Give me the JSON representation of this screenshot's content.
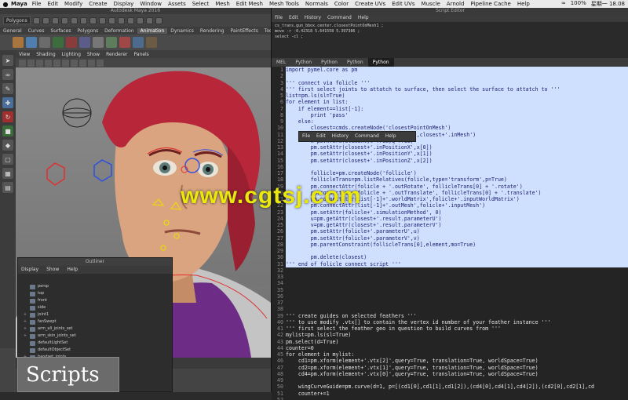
{
  "menubar": {
    "app": "Maya",
    "items": [
      "File",
      "Edit",
      "Modify",
      "Create",
      "Display",
      "Window",
      "Assets",
      "Select",
      "Mesh",
      "Edit Mesh",
      "Mesh Tools",
      "Normals",
      "Color",
      "Create UVs",
      "Edit UVs",
      "Muscle",
      "Arnold",
      "Pipeline Cache",
      "Help"
    ],
    "battery": "100%",
    "time": "星期一 18.08"
  },
  "maya": {
    "window_title": "Autodesk Maya 2016",
    "mode_select": "Polygons",
    "shelf_tabs": [
      "General",
      "Curves",
      "Surfaces",
      "Polygons",
      "Deformation",
      "Animation",
      "Dynamics",
      "Rendering",
      "PaintEffects",
      "Toon",
      "Muscle"
    ],
    "active_shelf_tab": "Animation",
    "panel_menu": [
      "View",
      "Shading",
      "Lighting",
      "Show",
      "Renderer",
      "Panels"
    ],
    "timeline_ticks": [
      "1",
      "40",
      "45",
      "50",
      "55"
    ]
  },
  "outliner": {
    "title": "Outliner",
    "menu": [
      "Display",
      "Show",
      "Help"
    ],
    "items": [
      {
        "label": "persp",
        "expand": ""
      },
      {
        "label": "top",
        "expand": ""
      },
      {
        "label": "front",
        "expand": ""
      },
      {
        "label": "side",
        "expand": ""
      },
      {
        "label": "joint1",
        "expand": "+"
      },
      {
        "label": "fanSwept",
        "expand": "+"
      },
      {
        "label": "arm_all_joints_set",
        "expand": "+"
      },
      {
        "label": "arm_skin_joints_set",
        "expand": "+"
      },
      {
        "label": "defaultLightSet",
        "expand": ""
      },
      {
        "label": "defaultObjectSet",
        "expand": ""
      },
      {
        "label": "handset_joints",
        "expand": "+"
      }
    ]
  },
  "caption": "Scripts",
  "watermark": "www.cgtsj.com",
  "script_editor": {
    "title": "Script Editor",
    "menu": [
      "File",
      "Edit",
      "History",
      "Command",
      "Help"
    ],
    "output_lines": [
      "cs_trans.gun_bbox.center.closestPointOnMesh1 ;",
      "move -r -0.42318 5.641558 5.397386 ;",
      "select -cl ;"
    ],
    "tabs": [
      "MEL",
      "Python",
      "Python",
      "Python",
      "Python"
    ],
    "active_tab": 4,
    "command_popup": [
      "File",
      "Edit",
      "History",
      "Command",
      "Help"
    ],
    "code_lines": [
      {
        "n": "1",
        "t": "import pymel.core as pm",
        "sel": true
      },
      {
        "n": "2",
        "t": "",
        "sel": true
      },
      {
        "n": "3",
        "t": "''' connect via folicle '''",
        "sel": true
      },
      {
        "n": "4",
        "t": "''' first select joints to attatch to surface, then select the surface to attatch to '''",
        "sel": true
      },
      {
        "n": "5",
        "t": "list=pm.ls(sl=True)",
        "sel": true
      },
      {
        "n": "6",
        "t": "for element in list:",
        "sel": true
      },
      {
        "n": "7",
        "t": "    if element==list[-1]:",
        "sel": true
      },
      {
        "n": "8",
        "t": "        print 'pass'",
        "sel": true
      },
      {
        "n": "9",
        "t": "    else:",
        "sel": true
      },
      {
        "n": "10",
        "t": "        closest=cmds.createNode('closestPointOnMesh')",
        "sel": true
      },
      {
        "n": "11",
        "t": "        pm.connectAttr(list[-1]+'.outMesh',closest+'.inMesh')",
        "sel": true
      },
      {
        "n": "12",
        "t": "        x=pm.xform(element,t=True,q=True)",
        "sel": true
      },
      {
        "n": "13",
        "t": "        pm.setAttr(closest+'.inPositionX',x[0])",
        "sel": true
      },
      {
        "n": "14",
        "t": "        pm.setAttr(closest+'.inPositionY',x[1])",
        "sel": true
      },
      {
        "n": "15",
        "t": "        pm.setAttr(closest+'.inPositionZ',x[2])",
        "sel": true
      },
      {
        "n": "16",
        "t": "",
        "sel": true
      },
      {
        "n": "17",
        "t": "        follicle=pm.createNode('follicle')",
        "sel": true
      },
      {
        "n": "18",
        "t": "        follicleTrans=pm.listRelatives(folicle,type='transform',p=True)",
        "sel": true
      },
      {
        "n": "19",
        "t": "        pm.connectAttr(folicle + '.outRotate', follicleTrans[0] + '.rotate')",
        "sel": true
      },
      {
        "n": "20",
        "t": "        pm.connectAttr(folicle + '.outTranslate', follicleTrans[0] + '.translate')",
        "sel": true
      },
      {
        "n": "21",
        "t": "        pm.connectAttr(list[-1]+'.worldMatrix',folicle+'.inputWorldMatrix')",
        "sel": true
      },
      {
        "n": "22",
        "t": "        pm.connectAttr(list[-1]+'.outMesh',folicle+'.inputMesh')",
        "sel": true
      },
      {
        "n": "23",
        "t": "        pm.setAttr(folicle+'.simulationMethod', 0)",
        "sel": true
      },
      {
        "n": "24",
        "t": "        u=pm.getAttr(closest+'.result.parameterU')",
        "sel": true
      },
      {
        "n": "25",
        "t": "        v=pm.getAttr(closest+'.result.parameterV')",
        "sel": true
      },
      {
        "n": "26",
        "t": "        pm.setAttr(folicle+'.parameterU',u)",
        "sel": true
      },
      {
        "n": "27",
        "t": "        pm.setAttr(folicle+'.parameterV',v)",
        "sel": true
      },
      {
        "n": "28",
        "t": "        pm.parentConstraint(follicleTrans[0],element,mo=True)",
        "sel": true
      },
      {
        "n": "29",
        "t": "",
        "sel": true
      },
      {
        "n": "30",
        "t": "        pm.delete(closest)",
        "sel": true
      },
      {
        "n": "31",
        "t": "''' end of folicle connect script '''",
        "sel": true
      },
      {
        "n": "32",
        "t": "",
        "sel": false
      },
      {
        "n": "33",
        "t": "",
        "sel": false
      },
      {
        "n": "34",
        "t": "",
        "sel": false
      },
      {
        "n": "35",
        "t": "",
        "sel": false
      },
      {
        "n": "36",
        "t": "",
        "sel": false
      },
      {
        "n": "37",
        "t": "",
        "sel": false
      },
      {
        "n": "38",
        "t": "",
        "sel": false
      },
      {
        "n": "39",
        "t": "''' create guides on selected feathers '''",
        "sel": false
      },
      {
        "n": "40",
        "t": "''' to use modify .vtx[] to contain the vertex id number of your feather instance '''",
        "sel": false
      },
      {
        "n": "41",
        "t": "''' first select the feather geo in question to build curves from '''",
        "sel": false
      },
      {
        "n": "42",
        "t": "mylist=pm.ls(sl=True)",
        "sel": false
      },
      {
        "n": "43",
        "t": "pm.select(d=True)",
        "sel": false
      },
      {
        "n": "44",
        "t": "counter=0",
        "sel": false
      },
      {
        "n": "45",
        "t": "for element in mylist:",
        "sel": false
      },
      {
        "n": "46",
        "t": "    cd1=pm.xform(element+'.vtx[2]',query=True, translation=True, worldSpace=True)",
        "sel": false
      },
      {
        "n": "47",
        "t": "    cd2=pm.xform(element+'.vtx[1]',query=True, translation=True, worldSpace=True)",
        "sel": false
      },
      {
        "n": "48",
        "t": "    cd4=pm.xform(element+'.vtx[0]',query=True, translation=True, worldSpace=True)",
        "sel": false
      },
      {
        "n": "49",
        "t": "",
        "sel": false
      },
      {
        "n": "50",
        "t": "    wingCurveGuide=pm.curve(d=1, p=[(cd1[0],cd1[1],cd1[2]),(cd4[0],cd4[1],cd4[2]),(cd2[0],cd2[1],cd",
        "sel": false
      },
      {
        "n": "51",
        "t": "    counter+=1",
        "sel": false
      },
      {
        "n": "52",
        "t": "",
        "sel": false
      },
      {
        "n": "53",
        "t": "''' end of curve build script '''",
        "sel": false
      }
    ]
  },
  "colors": {
    "selection": "#cfe0ff",
    "watermark": "#ece90a",
    "hair": "#b8263a",
    "skin": "#d9a47f"
  }
}
